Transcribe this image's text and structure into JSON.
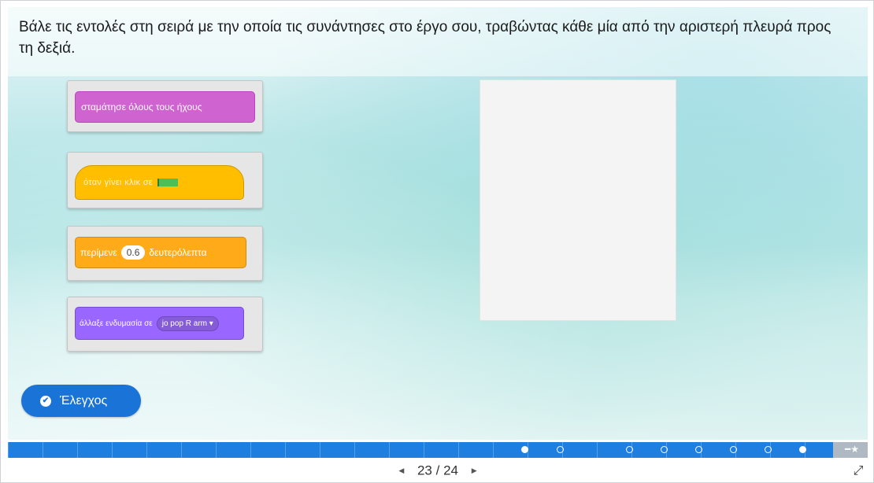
{
  "instructions": "Βάλε τις εντολές στη σειρά με την οποία τις συνάντησες στο έργο σου, τραβώντας κάθε μία από την αριστερή πλευρά προς τη δεξιά.",
  "blocks": {
    "stop_sounds": {
      "label": "σταμάτησε όλους τους ήχους",
      "color": "#cf63cf"
    },
    "when_flag": {
      "label": "όταν γίνει κλικ σε",
      "icon": "green-flag-icon",
      "color": "#ffbf00"
    },
    "wait": {
      "label_before": "περίμενε",
      "value": "0.6",
      "label_after": "δευτερόλεπτα",
      "color": "#ffab19"
    },
    "switch_costume": {
      "label": "άλλαξε ενδυμασία σε",
      "dropdown": "jo pop R arm",
      "color": "#9966ff"
    }
  },
  "check_button": {
    "label": "Έλεγχος",
    "icon": "check-circle-icon",
    "color": "#1a73d6"
  },
  "progress": {
    "current": 23,
    "total": 24,
    "color": "#1f7fe0"
  },
  "pagination": {
    "current": "23",
    "separator": "/",
    "total": "24",
    "prev_icon": "prev-arrow-icon",
    "next_icon": "next-arrow-icon"
  },
  "fullscreen_icon": "expand-icon"
}
